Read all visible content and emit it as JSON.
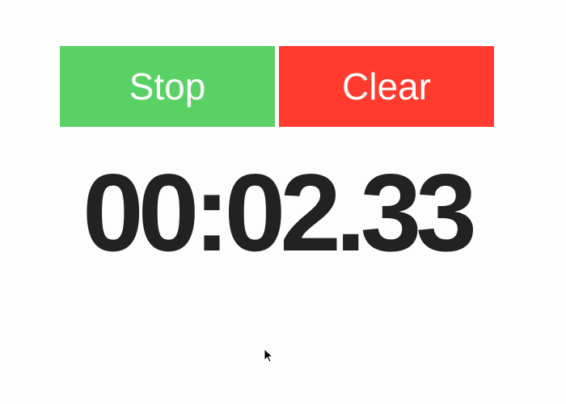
{
  "controls": {
    "stop_label": "Stop",
    "clear_label": "Clear"
  },
  "timer": {
    "display": "00:02.33"
  },
  "colors": {
    "stop_button": "#5ad165",
    "clear_button": "#ff3b30",
    "time_text": "#222222",
    "background": "#fdfdfd"
  },
  "icons": {
    "pointer": "mouse-pointer-icon"
  }
}
